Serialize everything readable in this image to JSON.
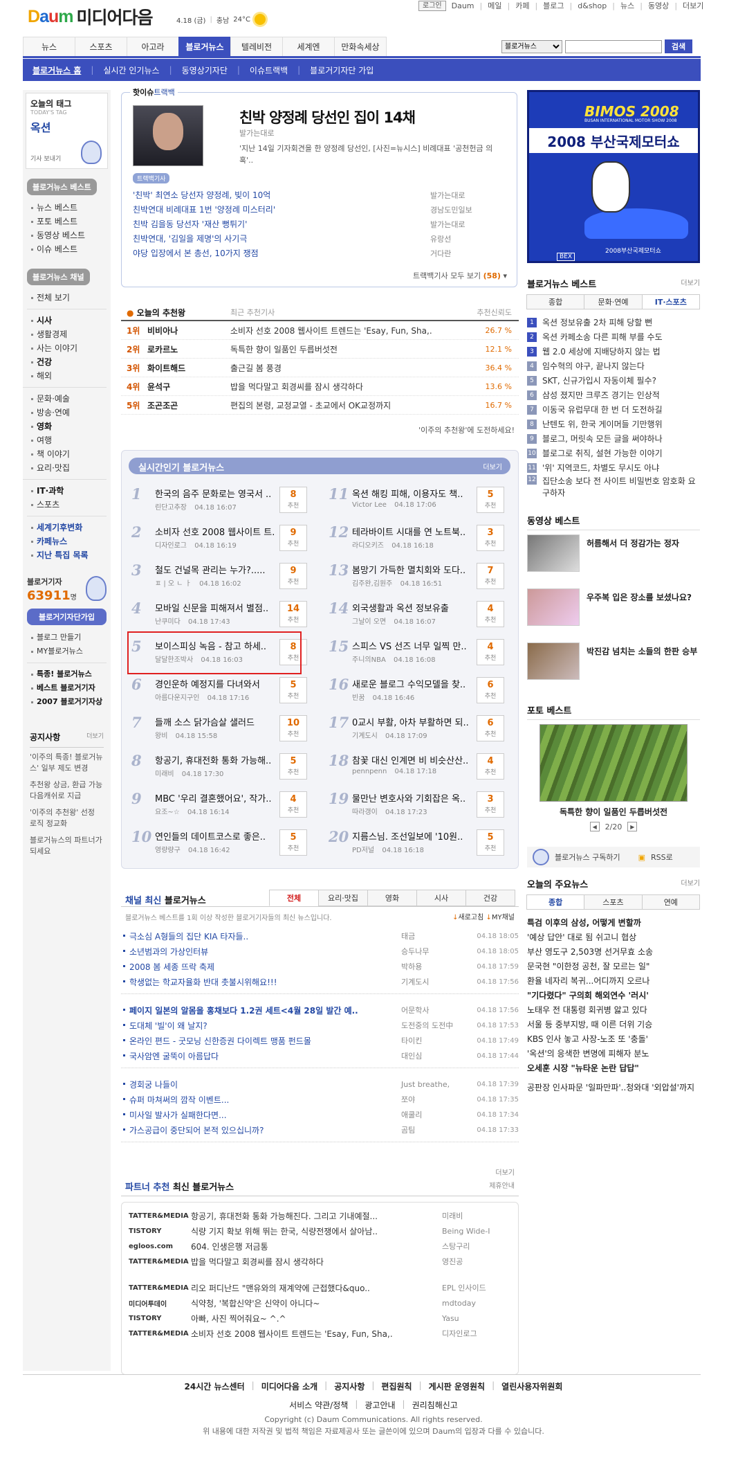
{
  "top_links": {
    "login": "로그인",
    "items": [
      "Daum",
      "메일",
      "카페",
      "블로그",
      "d&shop",
      "뉴스",
      "동영상",
      "더보기"
    ]
  },
  "logo": {
    "brand": "Daum",
    "title": "미디어다음"
  },
  "weather": {
    "date": "4.18 (금)",
    "region": "충남",
    "temp": "24°C"
  },
  "main_nav": [
    "뉴스",
    "스포츠",
    "아고라",
    "블로거뉴스",
    "텔레비전",
    "세계엔",
    "만화속세상"
  ],
  "search": {
    "select": "블로거뉴스",
    "button": "검색",
    "placeholder": ""
  },
  "sub_nav": [
    "블로거뉴스 홈",
    "실시간 인기뉴스",
    "동영상기자단",
    "이슈트랙백",
    "블로거기자단 가입"
  ],
  "left": {
    "tag_title": "오늘의 태그",
    "tag_sub": "TODAY'S TAG",
    "tag": "옥션",
    "tag_more": "기사 보내기",
    "best_hdr": "블로거뉴스 베스트",
    "best_items": [
      "뉴스 베스트",
      "포토 베스트",
      "동영상 베스트",
      "이슈 베스트"
    ],
    "channel_hdr": "블로거뉴스 채널",
    "channel_all": "전체 보기",
    "channel_items": [
      {
        "t": "시사",
        "b": true
      },
      {
        "t": "생활경제",
        "b": false
      },
      {
        "t": "사는 이야기",
        "b": false
      },
      {
        "t": "건강",
        "b": true
      },
      {
        "t": "해외",
        "b": false
      },
      {
        "t": "문화·예술",
        "b": false
      },
      {
        "t": "방송·연예",
        "b": false
      },
      {
        "t": "영화",
        "b": true
      },
      {
        "t": "여행",
        "b": false
      },
      {
        "t": "책 이야기",
        "b": false
      },
      {
        "t": "요리·맛집",
        "b": false
      },
      {
        "t": "IT·과학",
        "b": true
      },
      {
        "t": "스포츠",
        "b": false
      }
    ],
    "special_items": [
      "세계기후변화",
      "카페뉴스",
      "지난 특집 목록"
    ],
    "reporter_label": "블로거기자",
    "reporter_count": "63911",
    "reporter_unit": "명",
    "join_button": "블로거기자단가입",
    "my_items": [
      "블로그 만들기",
      "MY블로거뉴스"
    ],
    "notice_items": [
      "특종! 블로거뉴스",
      "베스트 블로거기자",
      "2007 블로거기자상"
    ],
    "notice_hdr": "공지사항",
    "notice_more": "더보기",
    "notices": [
      "'이주의 특종! 블로거뉴스' 일부 제도 변경",
      "추천왕 상금, 환급 가능 다음캐쉬로 지급",
      "'이주의 추천왕' 선정 로직 정교화",
      "블로거뉴스의 파트너가 되세요"
    ]
  },
  "issue": {
    "label": "핫이슈",
    "label2": "트랙백",
    "title": "친박 양정례 당선인 집이 14채",
    "source": "발가는대로",
    "summary": "'지난 14일 기자회견을 한 양정례 당선인, [사진=뉴시스] 비례대표 '공천헌금 의혹'..",
    "trackback_label": "트랙백기사",
    "rows": [
      {
        "t": "'친박' 최연소 당선자 양정례, 빚이 10억",
        "s": "발가는대로"
      },
      {
        "t": "친박연대 비례대표 1번 '양정례 미스터리'",
        "s": "경남도민일보"
      },
      {
        "t": "친박 김을동 당선자 '재산 뻥튀기'",
        "s": "발가는대로"
      },
      {
        "t": "친박연대, '김일을 제명'의 사기극",
        "s": "유랑선"
      },
      {
        "t": "야당 입장에서 본 총선, 10가지 쟁점",
        "s": "거다란"
      }
    ],
    "more": "트랙백기사 모두 보기",
    "more_count": "(58)"
  },
  "ranking": {
    "title": "오늘의 추천왕",
    "subtitle": "최근 추천기사",
    "col": "추천신뢰도",
    "rows": [
      {
        "r": "1위",
        "n": "비비아나",
        "t": "소비자 선호 2008 웹사이트 트렌드는 'Esay, Fun, Sha,.",
        "p": "26.7 %"
      },
      {
        "r": "2위",
        "n": "로카르노",
        "t": "독특한 향이 일품인 두릅버섯전",
        "p": "12.1 %"
      },
      {
        "r": "3위",
        "n": "화이트해드",
        "t": "출근길 봄 풍경",
        "p": "36.4 %"
      },
      {
        "r": "4위",
        "n": "윤석구",
        "t": "밥을 먹다말고 회경씨를 잠시 생각하다",
        "p": "13.6 %"
      },
      {
        "r": "5위",
        "n": "조곤조곤",
        "t": "편집의 본령, 교정교열 - 초교에서 OK교정까지",
        "p": "16.7 %"
      }
    ],
    "challenge": "'이주의 추천왕'에 도전하세요!"
  },
  "realtime": {
    "title": "실시간인기 블로거뉴스",
    "more": "더보기",
    "badge_label": "추천",
    "items": [
      {
        "n": "1",
        "t": "한국의 음주 문화로는 영국서 ..",
        "m": "린단고추장",
        "d": "04.18 16:07",
        "c": "8"
      },
      {
        "n": "2",
        "t": "소비자 선호 2008 웹사이트 트..",
        "m": "디자인로그",
        "d": "04.18 16:19",
        "c": "9"
      },
      {
        "n": "3",
        "t": "철도 건널목 관리는 누가?.....",
        "m": "ㅍ | 오 ㄴ ㅏ",
        "d": "04.18 16:02",
        "c": "9"
      },
      {
        "n": "4",
        "t": "모바일 신문을 피해져서 별점..",
        "m": "난쿠미다",
        "d": "04.18 17:43",
        "c": "14"
      },
      {
        "n": "5",
        "t": "보이스피싱 녹음 - 참고 하세..",
        "m": "달달한조박사",
        "d": "04.18 16:03",
        "c": "8"
      },
      {
        "n": "6",
        "t": "경인운하 예정지를 다녀와서",
        "m": "아름다운지구인",
        "d": "04.18 17:16",
        "c": "5"
      },
      {
        "n": "7",
        "t": "들깨 소스 닭가슴살 샐러드",
        "m": "왕비",
        "d": "04.18 15:58",
        "c": "10"
      },
      {
        "n": "8",
        "t": "항공기, 휴대전화 통화 가능해..",
        "m": "미래비",
        "d": "04.18 17:30",
        "c": "5"
      },
      {
        "n": "9",
        "t": "MBC '우리 결혼했어요', 작가..",
        "m": "요조~☆",
        "d": "04.18 16:14",
        "c": "4"
      },
      {
        "n": "10",
        "t": "연인들의 데이트코스로 좋은..",
        "m": "영량량구",
        "d": "04.18 16:42",
        "c": "5"
      },
      {
        "n": "11",
        "t": "옥션 해킹 피해, 이용자도 책..",
        "m": "Victor Lee",
        "d": "04.18 17:06",
        "c": "5"
      },
      {
        "n": "12",
        "t": "테라바이트 시대를 연 노트북..",
        "m": "라디오키즈",
        "d": "04.18 16:18",
        "c": "3"
      },
      {
        "n": "13",
        "t": "봄망기 가득한 멸치회와 도다..",
        "m": "김주완,김원주",
        "d": "04.18 16:51",
        "c": "7"
      },
      {
        "n": "14",
        "t": "외국생활과 옥션 정보유출",
        "m": "그날이 오면",
        "d": "04.18 16:07",
        "c": "4"
      },
      {
        "n": "15",
        "t": "스피스 VS 선즈 너무 일찍 만..",
        "m": "주니의NBA",
        "d": "04.18 16:08",
        "c": "4"
      },
      {
        "n": "16",
        "t": "새로운 블로그 수익모델을 찾..",
        "m": "빈꿈",
        "d": "04.18 16:46",
        "c": "6"
      },
      {
        "n": "17",
        "t": "0교시 부활, 아차 부활하면 되..",
        "m": "기계도시",
        "d": "04.18 17:09",
        "c": "6"
      },
      {
        "n": "18",
        "t": "참꽃 대신 인계면 비 비슷산산..",
        "m": "pennpenn",
        "d": "04.18 17:18",
        "c": "4"
      },
      {
        "n": "19",
        "t": "물만난 변호사와 기회잡은 옥..",
        "m": "따라갱이",
        "d": "04.18 17:23",
        "c": "3"
      },
      {
        "n": "20",
        "t": "지름스님. 조선일보에 '10원..",
        "m": "PD저널",
        "d": "04.18 16:18",
        "c": "5"
      }
    ]
  },
  "channel": {
    "title": "채널 최신",
    "title2": "블로거뉴스",
    "tabs": [
      "전체",
      "요리·맛집",
      "영화",
      "시사",
      "건강"
    ],
    "desc": "블로거뉴스 베스트를 1회 이상 작성한 블로거기자들의 최신 뉴스입니다.",
    "refresh": "새로고침",
    "my": "MY채널",
    "groups": [
      [
        {
          "t": "극소심 A형들의 집단 KIA 타자들..",
          "w": "태금",
          "d": "04.18 18:05"
        },
        {
          "t": "소년범과의 가상인터뷰",
          "w": "승두나무",
          "d": "04.18 18:05"
        },
        {
          "t": "2008 봄 세종 뜨락 축제",
          "w": "박하용",
          "d": "04.18 17:59"
        },
        {
          "t": "학생없는 학교자율화 반대 촛불시위해요!!!",
          "w": "기계도시",
          "d": "04.18 17:56"
        }
      ],
      [
        {
          "t": "페이지 일본의 알몸을 홍채보다 1.2권 세트<4월 28일 발간 예..",
          "w": "어문학사",
          "d": "04.18 17:56"
        },
        {
          "t": "도대체 '빌'이 왜 날지?",
          "w": "도전중의 도전中",
          "d": "04.18 17:53"
        },
        {
          "t": "온라인 편드 - 굿모닝 신한증권 다이렉트 맹품 펀드몰",
          "w": "타이킨",
          "d": "04.18 17:49"
        },
        {
          "t": "국사암엔 굴뚝이 아름답다",
          "w": "대인심",
          "d": "04.18 17:44"
        }
      ],
      [
        {
          "t": "경회궁 나들이",
          "w": "Just breathe,",
          "d": "04.18 17:39"
        },
        {
          "t": "슈퍼 마쳐써의 깜작 이벤트...",
          "w": "쪼야",
          "d": "04.18 17:35"
        },
        {
          "t": "미사일 발사가 실패한다면...",
          "w": "애쿨리",
          "d": "04.18 17:34"
        },
        {
          "t": "가스공급이 중단되어 본적 있으십니까?",
          "w": "곰팀",
          "d": "04.18 17:33"
        }
      ]
    ],
    "more": "더보기"
  },
  "partner": {
    "title": "파트너 추천",
    "title2": "최신 블로거뉴스",
    "guide": "제휴안내",
    "groups": [
      [
        {
          "l": "TATTER&MEDIA",
          "t": "항공기, 휴대전화 통화 가능해진다. 그리고 기내예절...",
          "w": "미래비"
        },
        {
          "l": "TISTORY",
          "t": "식량 기지 확보 위해 뛰는 한국, 식량전쟁에서 살아남..",
          "w": "Being Wide-I"
        },
        {
          "l": "egloos.com",
          "t": "604. 인생은행 저금통",
          "w": "스탕구리"
        },
        {
          "l": "TATTER&MEDIA",
          "t": "밥을 먹다말고 회경씨를 잠시 생각하다",
          "w": "영진공"
        }
      ],
      [
        {
          "l": "TATTER&MEDIA",
          "t": "리오 퍼디난드 \"맨유와의 재계약에 근접했다&quo..",
          "w": "EPL 인사이드"
        },
        {
          "l": "미디어투데이",
          "t": "식약청, '복합신약'은 신약이 아니다~",
          "w": "mdtoday"
        },
        {
          "l": "TISTORY",
          "t": "아빠, 사진 찍어줘요~ ^.^",
          "w": "Yasu"
        },
        {
          "l": "TATTER&MEDIA",
          "t": "소비자 선호 2008 웹사이트 트렌드는 'Esay, Fun, Sha,.",
          "w": "디자인로그"
        }
      ]
    ]
  },
  "right": {
    "banner_top": "BIMOS 2008",
    "banner_sub": "BUSAN INTERNATIONAL MOTOR SHOW 2008",
    "banner_title": "2008 부산국제모터쇼",
    "banner_foot": "2008부산국제모터쇼",
    "banner_btn": "BEX",
    "best_title": "블로거뉴스 베스트",
    "more": "더보기",
    "best_tabs": [
      "종합",
      "문화·연예",
      "IT·스포츠"
    ],
    "best_items": [
      "옥션 정보유출 2차 피해 당할 뻔",
      "옥션 카페소송 다른 피해 부를 수도",
      "웹 2.0 세상에 지배당하지 않는 법",
      "임수혁의 야구, 끝나지 않는다",
      "SKT, 신규가입시 자동이체 필수?",
      "삼성 졌지만 크루즈 경기는 인상적",
      "이동국 유럽무대 한 번 더 도전하길",
      "난텐도 위, 한국 게이머들 기만행위",
      "블로그, 머릿속 모든 글을 써야하나",
      "블로그로 취직, 설현 가능한 이야기",
      "'위' 지역코드, 차별도 무시도 아냐",
      "집단소송 보다 전 사이트 비밀번호 암호화 요구하자"
    ],
    "video_title": "동영상 베스트",
    "videos": [
      "허름해서 더 정감가는 정자",
      "우주복 입은 장소를 보셨나요?",
      "박진감 넘치는 소들의 한판 승부"
    ],
    "photo_title": "포토 베스트",
    "photo_caption": "독특한 향이 일품인 두릅버섯전",
    "photo_page": "2/20",
    "subscribe": "블로거뉴스 구독하기",
    "rss": "RSS로",
    "main_title": "오늘의 주요뉴스",
    "main_tabs": [
      "종합",
      "스포츠",
      "연예"
    ],
    "main_items": [
      "특검 이후의 삼성, 어떻게 변할까",
      "'예상 답안' 대로 됨 쉬고니 협상",
      "부산 영도구 2,503명 선거무효 소송",
      "문국현 \"이한정 공천, 잘 모르는 일\"",
      "환율 네자리 복귀...어디까지 오르나",
      "\"기다렸다\" 구의회 해외연수 '러시'",
      "노태우 전 대통령 회귀병 앓고 있다",
      "서울 등 중부지방, 때 이른 더위 기승",
      "KBS 인사 놓고 사장-노조 또 '충돌'",
      "'옥션'의 응색한 변명에 피해자 분노",
      "오세훈 시장 \"뉴타운 논란 답답\"",
      "공판장 인사파문 '일파만파'..청와대 '외압설'까지"
    ]
  },
  "footer": {
    "links": [
      "24시간 뉴스센터",
      "미디어다음 소개",
      "공지사항",
      "편집원칙",
      "게시판 운영원칙",
      "열린사용자위원회"
    ],
    "links2": [
      "서비스 약관/정책",
      "광고안내",
      "권리침해신고"
    ],
    "copy": "Copyright (c) Daum Communications. All rights reserved.",
    "notice": "위 내용에 대한 저작권 및 법적 책임은 자료제공사 또는 글쓴이에 있으며 Daum의 입장과 다를 수 있습니다."
  },
  "colors": {
    "brand": "#3b4fbd",
    "accent": "#e06a00",
    "link": "#2348a4",
    "highlight": "#e02020"
  }
}
